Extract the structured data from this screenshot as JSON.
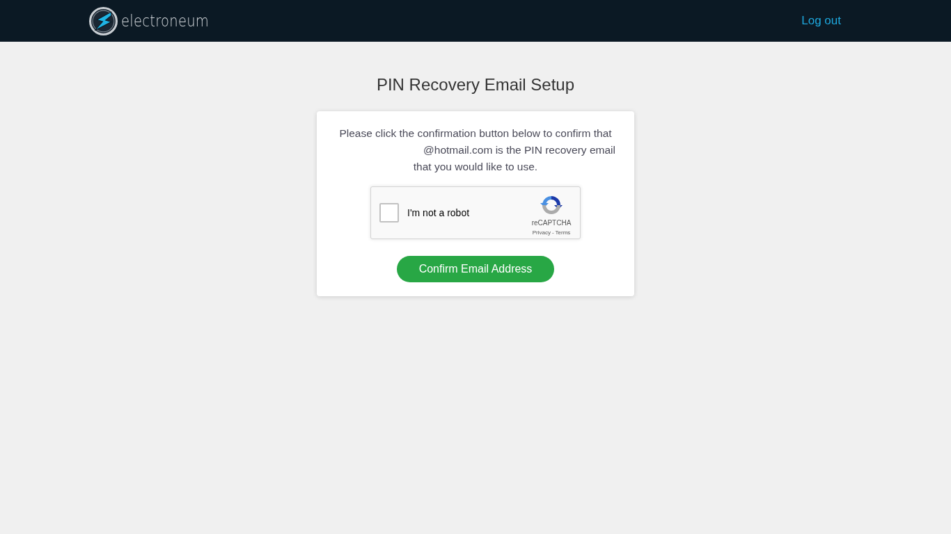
{
  "header": {
    "brand": "electroneum",
    "logout_link": "Log out"
  },
  "page_title": "PIN Recovery Email Setup",
  "card": {
    "message_lines": [
      "Please click the confirmation button below to confirm that",
      "@hotmail.com is the PIN recovery email",
      "that you would like to use."
    ],
    "recaptcha": {
      "label": "I'm not a robot",
      "checked": false,
      "brand": "reCAPTCHA",
      "privacy_link": "Privacy",
      "separator": "-",
      "terms_link": "Terms"
    },
    "confirm_button": "Confirm Email Address"
  }
}
